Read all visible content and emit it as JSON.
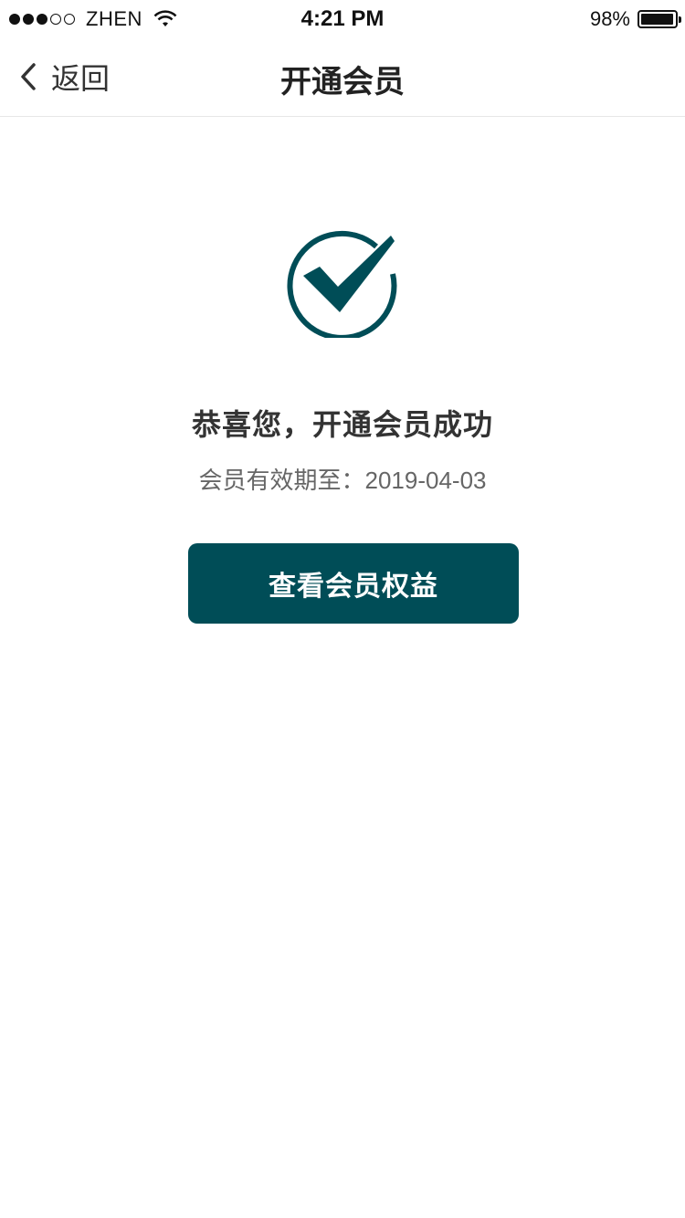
{
  "status_bar": {
    "carrier": "ZHEN",
    "time": "4:21 PM",
    "battery": "98%",
    "battery_level": 0.98,
    "signal_dots_filled": 3,
    "signal_dots_total": 5
  },
  "nav": {
    "back_label": "返回",
    "title": "开通会员"
  },
  "main": {
    "success_title": "恭喜您，开通会员成功",
    "expiry_text": "会员有效期至：2019-04-03",
    "view_button_label": "查看会员权益",
    "icon": "check-circle-icon"
  },
  "colors": {
    "accent": "#004d57",
    "text_primary": "#333333",
    "text_secondary": "#666666"
  }
}
